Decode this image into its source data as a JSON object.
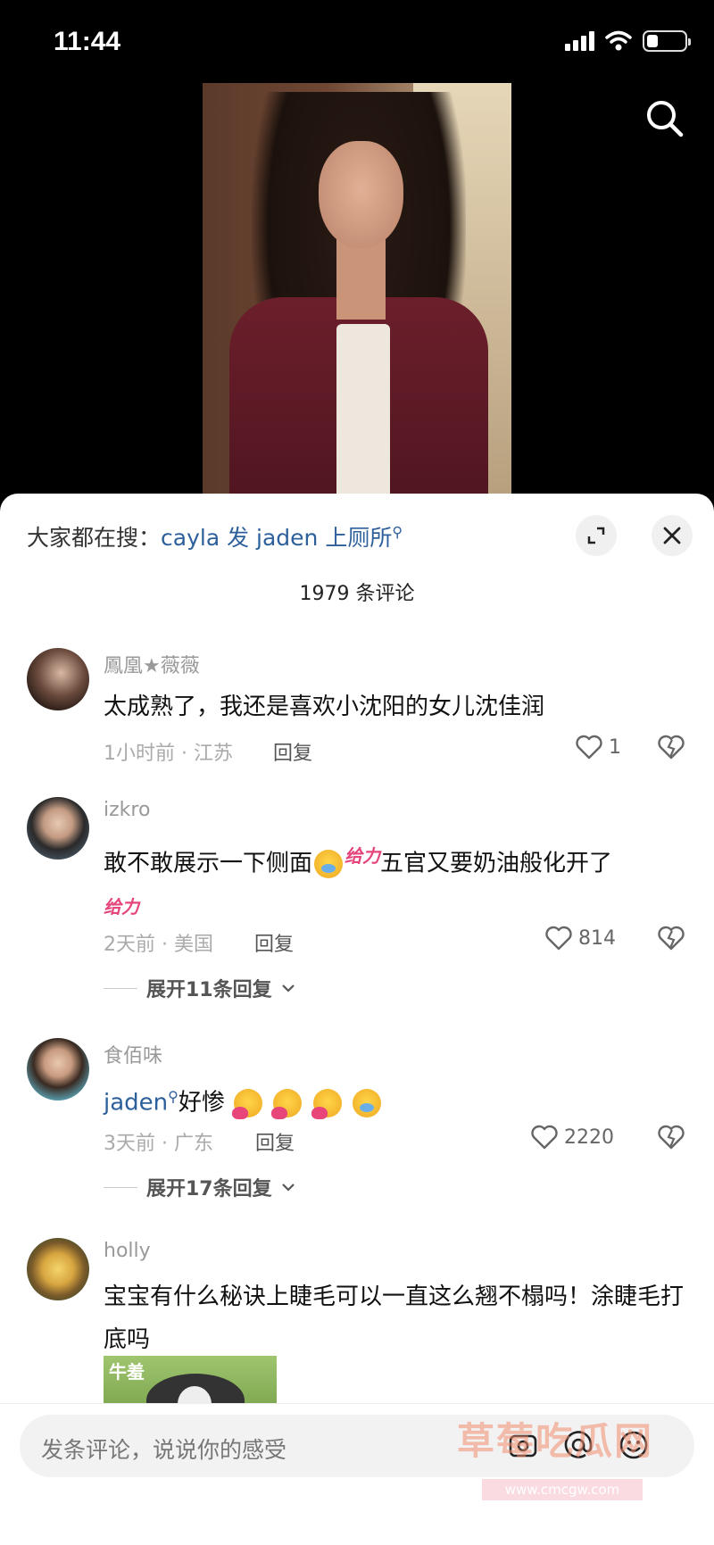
{
  "status_bar": {
    "time": "11:44"
  },
  "trending": {
    "prefix": "大家都在搜：",
    "keyword": "cayla 发 jaden 上厕所"
  },
  "comment_count": "1979 条评论",
  "comments": [
    {
      "username": "鳳凰★薇薇",
      "text": "太成熟了，我还是喜欢小沈阳的女儿沈佳润",
      "meta": "1小时前 · 江苏",
      "reply": "回复",
      "likes": "1"
    },
    {
      "username": "izkro",
      "text_a": "敢不敢展示一下侧面",
      "text_b": "五官又要奶油般化开了",
      "sticker": "给力",
      "meta": "2天前 · 美国",
      "reply": "回复",
      "likes": "814",
      "expand": "展开11条回复"
    },
    {
      "username": "食佰味",
      "keyword": "jaden",
      "text": "好惨",
      "meta": "3天前 · 广东",
      "reply": "回复",
      "likes": "2220",
      "expand": "展开17条回复"
    },
    {
      "username": "holly",
      "text": "宝宝有什么秘诀上睫毛可以一直这么翘不榻吗！涂睫毛打底吗",
      "image_caption": "牛羞"
    }
  ],
  "input": {
    "placeholder": "发条评论，说说你的感受"
  },
  "watermark": {
    "text": "草莓吃瓜网",
    "url": "www.cmcgw.com"
  },
  "icons": [
    "search-icon",
    "expand-icon",
    "close-icon",
    "heart-icon",
    "dislike-icon",
    "chevron-down-icon",
    "emoji-icon",
    "at-icon"
  ]
}
